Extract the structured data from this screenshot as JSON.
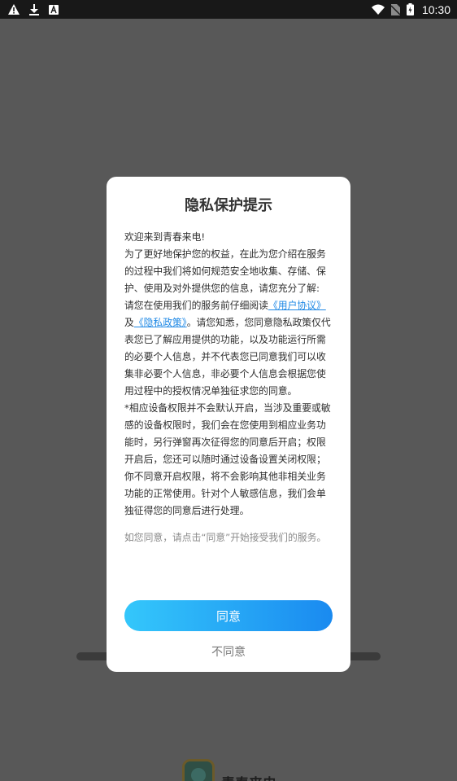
{
  "status_bar": {
    "time": "10:30",
    "left_icons": [
      "alert-icon",
      "download-icon",
      "a-box-icon"
    ],
    "right_icons": [
      "wifi-icon",
      "no-sim-icon",
      "battery-icon"
    ]
  },
  "background": {
    "app_name": "青春来电"
  },
  "dialog": {
    "title": "隐私保护提示",
    "p1": "欢迎来到青春来电!",
    "p2": "为了更好地保护您的权益，在此为您介绍在服务的过程中我们将如何规范安全地收集、存储、保护、使用及对外提供您的信息，请您充分了解:",
    "p3_prefix": "请您在使用我们的服务前仔细阅读",
    "user_agreement_link": "《用户协议》",
    "and": "及",
    "privacy_policy_link": "《隐私政策》",
    "p3_suffix": "。请您知悉，您同意隐私政策仅代表您已了解应用提供的功能，以及功能运行所需的必要个人信息，并不代表您已同意我们可以收集非必要个人信息，非必要个人信息会根据您使用过程中的授权情况单独征求您的同意。",
    "p4": "*相应设备权限并不会默认开启，当涉及重要或敏感的设备权限时，我们会在您使用到相应业务功能时，另行弹窗再次征得您的同意后开启；权限开启后，您还可以随时通过设备设置关闭权限；你不同意开启权限，将不会影响其他非相关业务功能的正常使用。针对个人敏感信息，我们会单独征得您的同意后进行处理。",
    "hint": "如您同意，请点击“同意”开始接受我们的服务。",
    "agree_label": "同意",
    "disagree_label": "不同意"
  },
  "colors": {
    "overlay": "#585858",
    "link": "#1e88e5",
    "button_gradient_start": "#34c7fb",
    "button_gradient_end": "#1a8af0"
  }
}
